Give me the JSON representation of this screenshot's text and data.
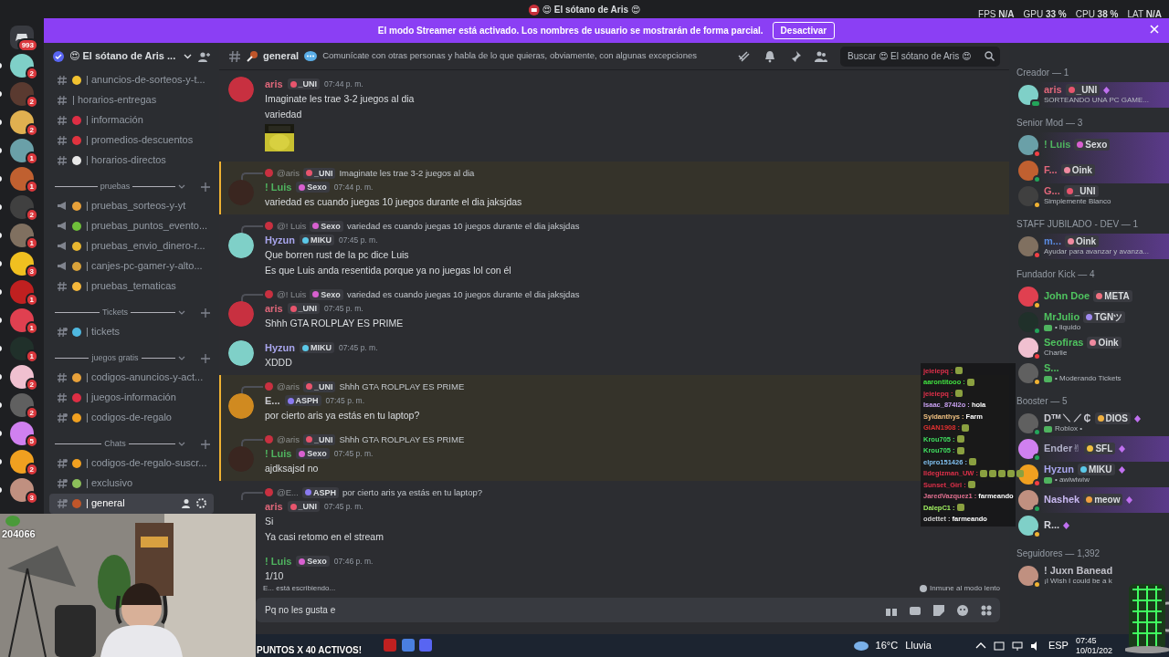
{
  "title_bar": {
    "title": "😍 El sótano de Aris 😍",
    "stats": [
      {
        "label": "FPS",
        "value": "N/A"
      },
      {
        "label": "GPU",
        "value": "33 %"
      },
      {
        "label": "CPU",
        "value": "38 %"
      },
      {
        "label": "LAT",
        "value": "N/A"
      }
    ]
  },
  "servers": {
    "home_badge": "993",
    "items": [
      {
        "badge": "2",
        "unread": true
      },
      {
        "badge": "2",
        "unread": true
      },
      {
        "badge": "2",
        "unread": true
      },
      {
        "badge": "1",
        "unread": true
      },
      {
        "badge": "1",
        "unread": true
      },
      {
        "badge": "2",
        "unread": true
      },
      {
        "badge": "1",
        "unread": true
      },
      {
        "badge": "3",
        "unread": true
      },
      {
        "badge": "1",
        "unread": true
      },
      {
        "badge": "1",
        "unread": true
      },
      {
        "badge": "1",
        "unread": true
      },
      {
        "badge": "2",
        "unread": true
      },
      {
        "badge": "2",
        "unread": true
      },
      {
        "badge": "5",
        "unread": true
      },
      {
        "badge": "2",
        "unread": true
      },
      {
        "badge": "3",
        "unread": true
      }
    ]
  },
  "banner": {
    "text": "El modo Streamer está activado. Los nombres de usuario se mostrarán de forma parcial.",
    "button": "Desactivar"
  },
  "sidebar": {
    "server_name": "😍 El sótano de Aris ...",
    "channels": [
      {
        "name": "| anuncios-de-sorteos-y-t...",
        "kind": "text",
        "color": "#f2c230",
        "selected": false
      },
      {
        "name": "| horarios-entregas",
        "kind": "text",
        "selected": false
      },
      {
        "name": "| información",
        "kind": "text",
        "color": "#dd2e44",
        "selected": false
      },
      {
        "name": "| promedios-descuentos",
        "kind": "text",
        "color": "#e0333f",
        "selected": false
      },
      {
        "name": "| horarios-directos",
        "kind": "text",
        "color": "#e8e8e8",
        "selected": false
      }
    ],
    "categories": [
      {
        "name": "pruebas",
        "channels": [
          {
            "name": "| pruebas_sorteos-y-yt",
            "kind": "announcement",
            "color": "#e8a13a",
            "selected": false
          },
          {
            "name": "| pruebas_puntos_evento...",
            "kind": "announcement",
            "color": "#6fbf3a",
            "selected": false
          },
          {
            "name": "| pruebas_envio_dinero-r...",
            "kind": "announcement",
            "color": "#e8b630",
            "selected": false
          },
          {
            "name": "| canjes-pc-gamer-y-alto...",
            "kind": "announcement",
            "color": "#d9a23a",
            "selected": false
          },
          {
            "name": "| pruebas_tematicas",
            "kind": "text",
            "color": "#f4b73b",
            "selected": false
          }
        ]
      },
      {
        "name": "Tickets",
        "channels": [
          {
            "name": "| tickets",
            "kind": "thread",
            "color": "#4fb8e0",
            "selected": false
          }
        ]
      },
      {
        "name": "juegos gratis",
        "channels": [
          {
            "name": "| codigos-anuncios-y-act...",
            "kind": "text",
            "color": "#e8a13a",
            "selected": false
          },
          {
            "name": "| juegos-información",
            "kind": "text",
            "color": "#dd2e44",
            "selected": false
          },
          {
            "name": "| codigos-de-regalo",
            "kind": "thread",
            "color": "#f0a020",
            "selected": false
          }
        ]
      },
      {
        "name": "Chats",
        "channels": [
          {
            "name": "| codigos-de-regalo-suscr...",
            "kind": "thread",
            "color": "#f0a020",
            "selected": false
          },
          {
            "name": "| exclusivo",
            "kind": "thread",
            "color": "#8cbf5a",
            "selected": false
          },
          {
            "name": "| general",
            "kind": "thread",
            "color": "#c0562a",
            "selected": true
          }
        ]
      }
    ]
  },
  "header": {
    "channel": "general",
    "topic": "Comunícate con otras personas y habla de lo que quieras, obviamente, con algunas excepciones",
    "search_placeholder": "Buscar 😍 El sótano de Aris 😍"
  },
  "messages": [
    {
      "author": "aris",
      "color": "#e0677a",
      "badge": {
        "text": "_UNI",
        "color": "#e8556d"
      },
      "time": "07:44 p. m.",
      "lines": [
        "Imaginate les trae 3-2 juegos al dia",
        "variedad"
      ],
      "attachment": {
        "kind": "picture"
      },
      "mention": false,
      "avatar": true
    },
    {
      "reply": {
        "author": "@aris",
        "badge": {
          "text": "_UNI",
          "color": "#e8556d"
        },
        "text": "Imaginate les trae 3-2 juegos al dia"
      },
      "author": "! Luis",
      "color": "#4fb35f",
      "badge": {
        "text": "Sexo",
        "color": "#d860d0"
      },
      "time": "07:44 p. m.",
      "lines": [
        "variedad es cuando juegas 10 juegos durante el dia jaksjdas"
      ],
      "mention": true,
      "avatar": true
    },
    {
      "reply": {
        "author": "@! Luis",
        "badge": {
          "text": "Sexo",
          "color": "#d860d0"
        },
        "text": "variedad es cuando juegas 10 juegos durante el dia jaksjdas"
      },
      "author": "Hyzun",
      "color": "#a9a6ee",
      "badge": {
        "text": "MIKU",
        "color": "#5bc8e8"
      },
      "time": "07:45 p. m.",
      "lines": [
        "Que borren rust de la pc dice Luis",
        "Es que Luis anda resentida porque ya no juegas lol con él"
      ],
      "mention": false,
      "avatar": true
    },
    {
      "reply": {
        "author": "@! Luis",
        "badge": {
          "text": "Sexo",
          "color": "#d860d0"
        },
        "text": "variedad es cuando juegas 10 juegos durante el dia jaksjdas"
      },
      "author": "aris",
      "color": "#e0677a",
      "badge": {
        "text": "_UNI",
        "color": "#e8556d"
      },
      "time": "07:45 p. m.",
      "lines": [
        "Shhh GTA ROLPLAY ES PRIME"
      ],
      "mention": false,
      "avatar": true
    },
    {
      "author": "Hyzun",
      "color": "#a9a6ee",
      "badge": {
        "text": "MIKU",
        "color": "#5bc8e8"
      },
      "time": "07:45 p. m.",
      "lines": [
        "XDDD"
      ],
      "mention": false,
      "avatar": true
    },
    {
      "reply": {
        "author": "@aris",
        "badge": {
          "text": "_UNI",
          "color": "#e8556d"
        },
        "text": "Shhh GTA ROLPLAY ES PRIME"
      },
      "author": "E...",
      "color": "#c9c9cf",
      "badge": {
        "text": "ASPH",
        "color": "#8a7af0"
      },
      "time": "07:45 p. m.",
      "lines": [
        "por cierto aris ya estás en tu laptop?"
      ],
      "mention": true,
      "avatar": true
    },
    {
      "reply": {
        "author": "@aris",
        "badge": {
          "text": "_UNI",
          "color": "#e8556d"
        },
        "text": "Shhh GTA ROLPLAY ES PRIME"
      },
      "author": "! Luis",
      "color": "#4fb35f",
      "badge": {
        "text": "Sexo",
        "color": "#d860d0"
      },
      "time": "07:45 p. m.",
      "lines": [
        "ajdksajsd no"
      ],
      "mention": true,
      "avatar": true
    },
    {
      "reply": {
        "author": "@E...",
        "badge": {
          "text": "ASPH",
          "color": "#8a7af0"
        },
        "text": "por cierto aris ya estás en tu laptop?"
      },
      "author": "aris",
      "color": "#e0677a",
      "badge": {
        "text": "_UNI",
        "color": "#e8556d"
      },
      "time": "07:45 p. m.",
      "lines": [
        "Si",
        "Ya casi retomo en el stream"
      ],
      "mention": false,
      "avatar": false
    },
    {
      "author": "! Luis",
      "color": "#4fb35f",
      "badge": {
        "text": "Sexo",
        "color": "#d860d0"
      },
      "time": "07:46 p. m.",
      "lines": [
        "1/10"
      ],
      "avatar": false
    }
  ],
  "typing": "E... está escribiendo...",
  "slowmode": "Inmune al modo lento",
  "composer": {
    "value": "Pq no les gusta e"
  },
  "member_groups": [
    {
      "title": "Creador — 1",
      "members": [
        {
          "name": "aris",
          "color": "#e0677a",
          "badge": {
            "text": "_UNI",
            "color": "#e8556d"
          },
          "status": {
            "kind": "custom",
            "text": "SORTEANDO UNA PC GAME..."
          },
          "presence": {
            "kind": "mobile",
            "color": "#23a55a"
          },
          "booster": true,
          "nameplate": true
        }
      ]
    },
    {
      "title": "Senior Mod — 3",
      "members": [
        {
          "name": "! Luis",
          "color": "#4fb35f",
          "badge": {
            "text": "Sexo",
            "color": "#d860d0"
          },
          "presence": {
            "kind": "dot",
            "color": "#f23f43"
          },
          "booster": false,
          "nameplate": true
        },
        {
          "name": "F...",
          "color": "#e0677a",
          "badge": {
            "text": "Oink",
            "color": "#f08aa0"
          },
          "presence": {
            "kind": "dot",
            "color": "#23a55a"
          },
          "booster": false,
          "nameplate": true
        },
        {
          "name": "G...",
          "color": "#e0677a",
          "badge": {
            "text": "_UNI",
            "color": "#e8556d"
          },
          "status": {
            "kind": "custom",
            "text": "Simplemente Blanco"
          },
          "presence": {
            "kind": "dot",
            "color": "#f0b232"
          },
          "booster": false,
          "nameplate": false
        }
      ]
    },
    {
      "title": "STAFF JUBILADO - DEV — 1",
      "members": [
        {
          "name": "m...",
          "color": "#5a8be0",
          "badge": {
            "text": "Oink",
            "color": "#f08aa0"
          },
          "status": {
            "kind": "custom",
            "text": "Ayudar para avanzar y avanza..."
          },
          "presence": {
            "kind": "dot",
            "color": "#f23f43"
          },
          "booster": false,
          "nameplate": true
        }
      ]
    },
    {
      "title": "Fundador Kick — 4",
      "members": [
        {
          "name": "John Doe",
          "color": "#4fc35f",
          "badge": {
            "text": "META",
            "color": "#f07080"
          },
          "presence": {
            "kind": "dot",
            "color": "#f0b232"
          },
          "booster": false,
          "nameplate": false
        },
        {
          "name": "MrJulio",
          "color": "#4fc35f",
          "badge": {
            "text": "TGNツ",
            "color": "#a08af0"
          },
          "status": {
            "kind": "game",
            "text": "• liquido"
          },
          "presence": {
            "kind": "dot",
            "color": "#23a55a"
          },
          "booster": false,
          "nameplate": false
        },
        {
          "name": "Seofiras",
          "color": "#4fc35f",
          "badge": {
            "text": "Oink",
            "color": "#f08aa0"
          },
          "status": {
            "kind": "custom",
            "text": "Charlie"
          },
          "presence": {
            "kind": "dot",
            "color": "#f23f43"
          },
          "booster": false,
          "nameplate": false
        },
        {
          "name": "S...",
          "color": "#4fc35f",
          "status": {
            "kind": "game",
            "text": "• Moderando Tickets"
          },
          "presence": {
            "kind": "dot",
            "color": "#f0b232"
          },
          "booster": false,
          "nameplate": false
        }
      ]
    },
    {
      "title": "Booster — 5",
      "members": [
        {
          "name": "Dᵀᴹ ⟍ ⟋ ₵",
          "color": "#d0d0d8",
          "badge": {
            "text": "DIOS",
            "color": "#f0b040"
          },
          "status": {
            "kind": "game",
            "text": "Roblox •"
          },
          "presence": {
            "kind": "dot",
            "color": "#23a55a"
          },
          "booster": true,
          "nameplate": false
        },
        {
          "name": "Ender✌",
          "color": "#b0b0c8",
          "badge": {
            "text": "SFL",
            "color": "#f0c040"
          },
          "presence": {
            "kind": "dot",
            "color": "#23a55a"
          },
          "booster": true,
          "nameplate": true
        },
        {
          "name": "Hyzun",
          "color": "#a9a6ee",
          "badge": {
            "text": "MIKU",
            "color": "#5bc8e8"
          },
          "status": {
            "kind": "game",
            "text": "• awiwiwiw"
          },
          "presence": {
            "kind": "dot",
            "color": "#f23f43"
          },
          "booster": true,
          "nameplate": false
        },
        {
          "name": "Nashek",
          "color": "#c8b8f0",
          "badge": {
            "text": "meow",
            "color": "#f0a040"
          },
          "presence": {
            "kind": "dot",
            "color": "#23a55a"
          },
          "booster": true,
          "nameplate": true
        },
        {
          "name": "R...",
          "color": "#d8d8e0",
          "presence": {
            "kind": "dot",
            "color": "#f0b232"
          },
          "booster": true,
          "nameplate": false
        }
      ]
    },
    {
      "title": "Seguidores — 1,392",
      "members": [
        {
          "name": "! Juxn Banead",
          "color": "#c0c0c8",
          "status": {
            "kind": "custom",
            "text": "¡I Wish I could be a k"
          },
          "presence": {
            "kind": "dot",
            "color": "#f0b232"
          },
          "booster": false,
          "nameplate": false
        }
      ]
    }
  ],
  "stream_chat": [
    {
      "user": "jeieiepq :",
      "color": "#e0304a",
      "emotes": [
        {
          "kind": "emote"
        }
      ]
    },
    {
      "user": "aarontitooo :",
      "color": "#40e040",
      "emotes": [
        {
          "kind": "emote"
        }
      ]
    },
    {
      "user": "jeieiepq :",
      "color": "#e0304a",
      "emotes": [
        {
          "kind": "emote"
        }
      ]
    },
    {
      "user": "Isaac_874l2o :",
      "color": "#c8a0f0",
      "message": "hola"
    },
    {
      "user": "Syldanthys :",
      "color": "#f0c080",
      "message": "Farm"
    },
    {
      "user": "GIAN1908 :",
      "color": "#e03030",
      "emotes": [
        {
          "kind": "emote"
        }
      ]
    },
    {
      "user": "Krou705 :",
      "color": "#40e060",
      "emotes": [
        {
          "kind": "emote"
        }
      ]
    },
    {
      "user": "Krou705 :",
      "color": "#40e060",
      "emotes": [
        {
          "kind": "emote"
        }
      ]
    },
    {
      "user": "elpro151426 :",
      "color": "#80c0f0",
      "emotes": [
        {
          "kind": "emote"
        }
      ]
    },
    {
      "user": "Ildegizman_UW :",
      "color": "#e0304a",
      "emotes": [
        {
          "kind": "emote"
        },
        {
          "kind": "emote"
        },
        {
          "kind": "emote"
        },
        {
          "kind": "emote"
        },
        {
          "kind": "emote"
        }
      ]
    },
    {
      "user": "Sunset_Girl :",
      "color": "#e0304a",
      "emotes": [
        {
          "kind": "emote"
        }
      ]
    },
    {
      "user": "JaredVazquez1 :",
      "color": "#e07090",
      "message": "farmeando"
    },
    {
      "user": "DalepC1 :",
      "color": "#a0f060",
      "emotes": [
        {
          "kind": "emote"
        }
      ]
    },
    {
      "user": "odettet :",
      "color": "#d0d0d0",
      "message": "farmeando"
    }
  ],
  "stream_overlay": {
    "counter": "204066",
    "caption": "PUNTOS X 40 ACTIVOS!"
  },
  "taskbar": {
    "temperature": "16°C",
    "weather": "Lluvia",
    "language": "ESP",
    "time": "07:45",
    "date": "10/01/202"
  }
}
